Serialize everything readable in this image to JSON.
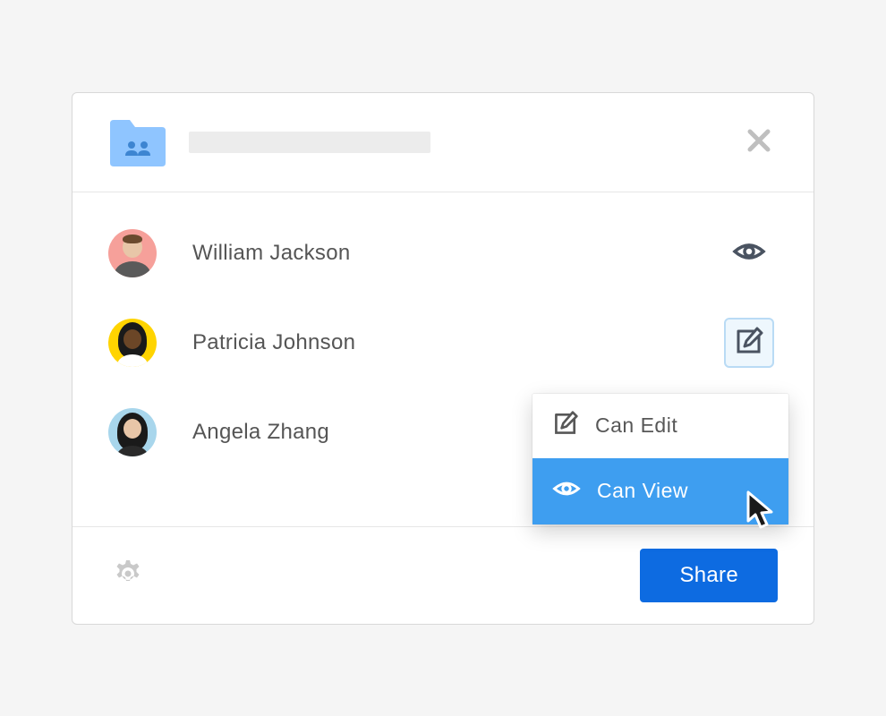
{
  "members": [
    {
      "name": "William Jackson",
      "permission_icon": "eye-icon",
      "avatar_bg": "#f6a09a"
    },
    {
      "name": "Patricia Johnson",
      "permission_icon": "edit-icon",
      "avatar_bg": "#ffd400",
      "highlighted": true
    },
    {
      "name": "Angela Zhang",
      "permission_icon": "none",
      "avatar_bg": "#a8d6ec"
    }
  ],
  "dropdown": {
    "options": [
      {
        "icon": "edit-icon",
        "label": "Can Edit",
        "selected": false
      },
      {
        "icon": "eye-icon",
        "label": "Can View",
        "selected": true
      }
    ]
  },
  "footer": {
    "share_label": "Share"
  },
  "colors": {
    "accent": "#0d6be1",
    "dropdown_selected": "#3e9ef0",
    "folder": "#8fc5ff",
    "folder_dark": "#60a8f0"
  }
}
